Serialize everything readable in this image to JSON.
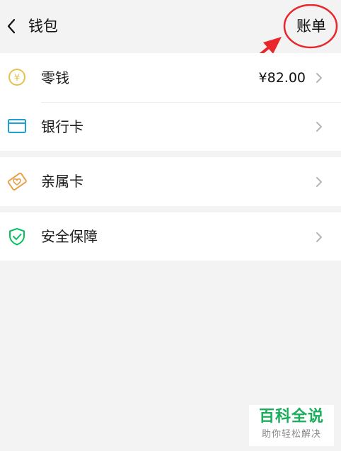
{
  "header": {
    "title": "钱包",
    "bill_label": "账单"
  },
  "wallet": {
    "change": {
      "label": "零钱",
      "amount": "¥82.00",
      "icon": "yuan-coin-icon"
    },
    "bank_card": {
      "label": "银行卡",
      "icon": "bank-card-icon"
    }
  },
  "family_card": {
    "label": "亲属卡",
    "icon": "family-card-icon"
  },
  "security": {
    "label": "安全保障",
    "icon": "shield-check-icon"
  },
  "watermark": {
    "title": "百科全说",
    "subtitle": "助你轻松解决"
  },
  "colors": {
    "accent_green": "#07c160",
    "coin_yellow": "#e6c24a",
    "card_blue": "#1e9fd6",
    "family_orange": "#e8a04a",
    "annotation_red": "#e8262b"
  }
}
